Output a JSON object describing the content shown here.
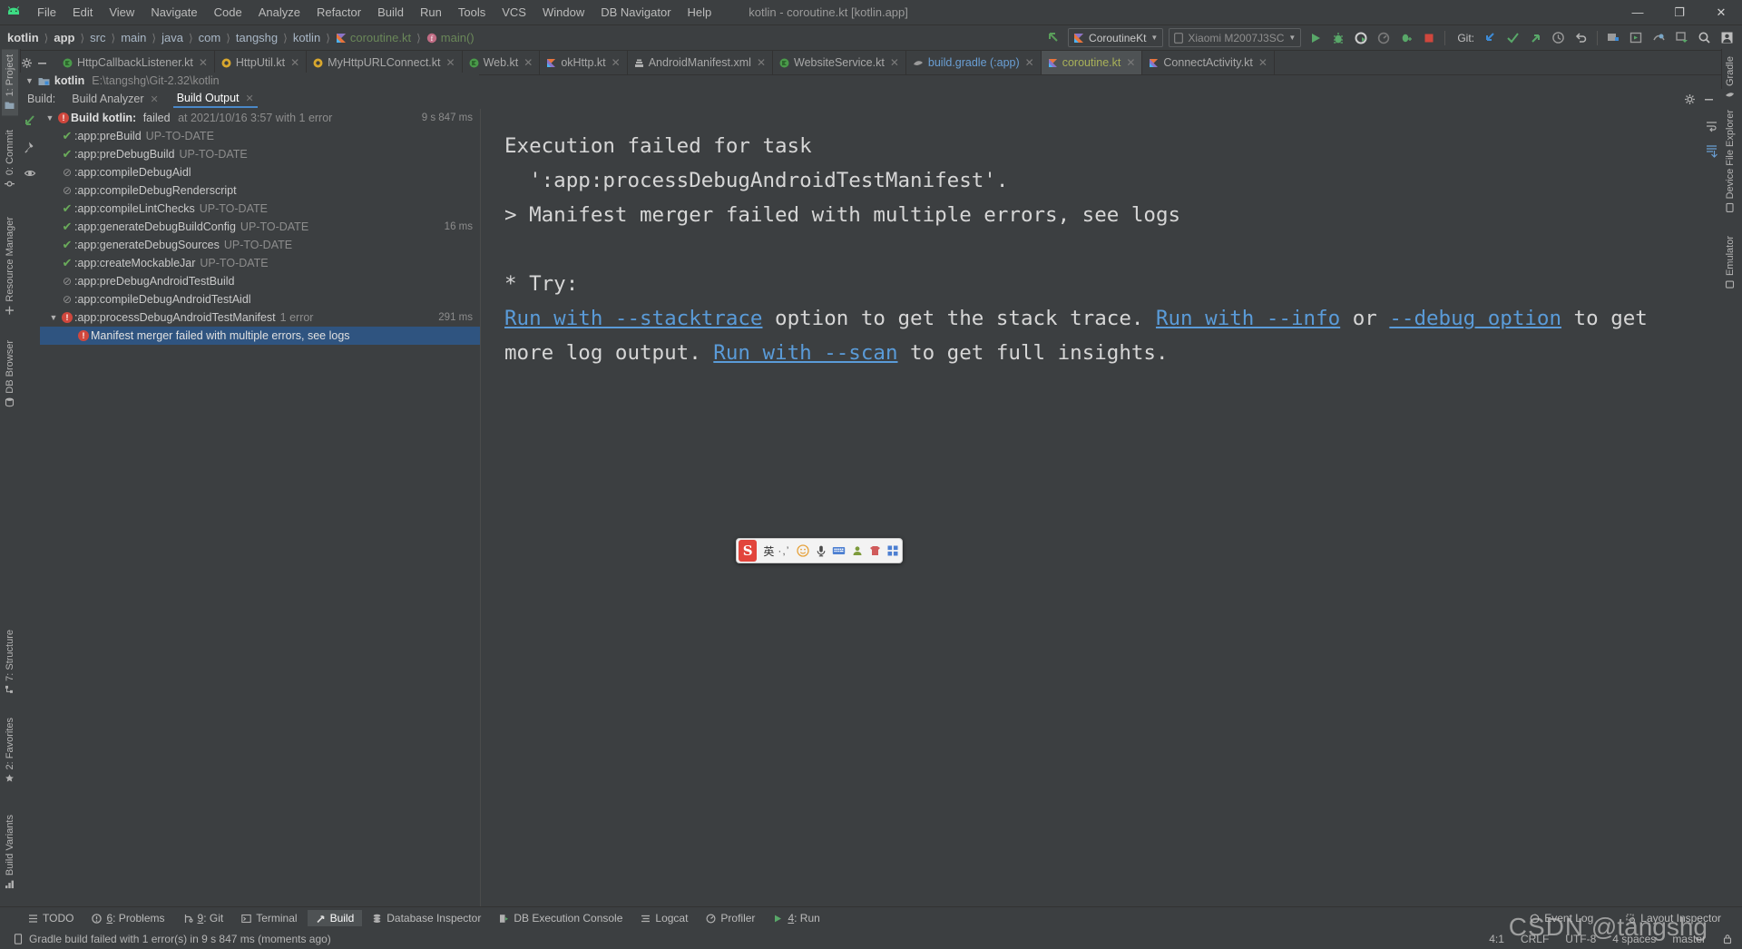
{
  "window": {
    "title": "kotlin - coroutine.kt [kotlin.app]",
    "minimize": "—",
    "maximize": "❐",
    "close": "✕"
  },
  "menu": {
    "items": [
      "File",
      "Edit",
      "View",
      "Navigate",
      "Code",
      "Analyze",
      "Refactor",
      "Build",
      "Run",
      "Tools",
      "VCS",
      "Window",
      "DB Navigator",
      "Help"
    ]
  },
  "breadcrumb": {
    "items": [
      {
        "label": "kotlin",
        "style": "bold"
      },
      {
        "label": "app",
        "style": "bold"
      },
      {
        "label": "src",
        "style": "normal"
      },
      {
        "label": "main",
        "style": "normal"
      },
      {
        "label": "java",
        "style": "normal"
      },
      {
        "label": "com",
        "style": "normal"
      },
      {
        "label": "tangshg",
        "style": "normal"
      },
      {
        "label": "kotlin",
        "style": "normal"
      },
      {
        "label": "coroutine.kt",
        "style": "file"
      },
      {
        "label": "main()",
        "style": "func"
      }
    ]
  },
  "toolbar": {
    "run_config": "CoroutineKt",
    "device": "Xiaomi M2007J3SC",
    "git_label": "Git:",
    "buttons": [
      "run-button",
      "debug-button",
      "run-coverage-button",
      "profiler-button",
      "attach-debugger-button",
      "stop-button"
    ],
    "git_buttons": [
      "update-project-icon",
      "commit-icon",
      "push-icon",
      "history-icon",
      "rollback-icon"
    ],
    "right_buttons": [
      "avd-manager-icon",
      "sdk-manager-icon",
      "layout-inspector-icon",
      "device-explorer-icon",
      "search-icon",
      "profile-icon"
    ]
  },
  "editor_tabs": [
    {
      "label": "HttpCallbackListener.kt",
      "icon": "kotlin-class-icon",
      "active": false
    },
    {
      "label": "HttpUtil.kt",
      "icon": "kotlin-object-icon",
      "active": false
    },
    {
      "label": "MyHttpURLConnect.kt",
      "icon": "kotlin-object-icon",
      "active": false
    },
    {
      "label": "Web.kt",
      "icon": "kotlin-class-icon",
      "active": false
    },
    {
      "label": "okHttp.kt",
      "icon": "kotlin-file-icon",
      "active": false
    },
    {
      "label": "AndroidManifest.xml",
      "icon": "manifest-icon",
      "active": false
    },
    {
      "label": "WebsiteService.kt",
      "icon": "kotlin-class-icon",
      "active": false
    },
    {
      "label": "build.gradle (:app)",
      "icon": "gradle-icon",
      "active": false
    },
    {
      "label": "coroutine.kt",
      "icon": "kotlin-file-icon",
      "active": true
    },
    {
      "label": "ConnectActivity.kt",
      "icon": "kotlin-file-icon",
      "active": false
    }
  ],
  "left_tool_tabs": [
    {
      "label": "1: Project",
      "icon": "project-icon",
      "selected": true
    },
    {
      "label": "0: Commit",
      "icon": "commit-icon",
      "selected": false
    },
    {
      "label": "Resource Manager",
      "icon": "resource-icon",
      "selected": false
    },
    {
      "label": "DB Browser",
      "icon": "db-icon",
      "selected": false
    },
    {
      "label": "7: Structure",
      "icon": "structure-icon",
      "selected": false
    },
    {
      "label": "2: Favorites",
      "icon": "star-icon",
      "selected": false
    },
    {
      "label": "Build Variants",
      "icon": "variants-icon",
      "selected": false
    }
  ],
  "right_tool_tabs": [
    {
      "label": "Gradle",
      "icon": "gradle-icon"
    },
    {
      "label": "Device File Explorer",
      "icon": "device-file-icon"
    },
    {
      "label": "Emulator",
      "icon": "emulator-icon"
    }
  ],
  "project_header": {
    "name": "kotlin",
    "path": "E:\\tangshg\\Git-2.32\\kotlin"
  },
  "build_window": {
    "label": "Build:",
    "tabs": [
      {
        "label": "Build Analyzer",
        "selected": false,
        "closable": true
      },
      {
        "label": "Build Output",
        "selected": true,
        "closable": true
      }
    ],
    "tree": [
      {
        "indent": 0,
        "twist": "⌄",
        "status": "error",
        "title": "Build kotlin:",
        "state": "failed",
        "detail": "at 2021/10/16 3:57 with 1 error",
        "time": "9 s 847 ms",
        "selected": false
      },
      {
        "indent": 1,
        "twist": "",
        "status": "ok",
        "title": ":app:preBuild",
        "state": "",
        "detail": "UP-TO-DATE",
        "time": "",
        "selected": false
      },
      {
        "indent": 1,
        "twist": "",
        "status": "ok",
        "title": ":app:preDebugBuild",
        "state": "",
        "detail": "UP-TO-DATE",
        "time": "",
        "selected": false
      },
      {
        "indent": 1,
        "twist": "",
        "status": "skip",
        "title": ":app:compileDebugAidl",
        "state": "",
        "detail": "",
        "time": "",
        "selected": false
      },
      {
        "indent": 1,
        "twist": "",
        "status": "skip",
        "title": ":app:compileDebugRenderscript",
        "state": "",
        "detail": "",
        "time": "",
        "selected": false
      },
      {
        "indent": 1,
        "twist": "",
        "status": "ok",
        "title": ":app:compileLintChecks",
        "state": "",
        "detail": "UP-TO-DATE",
        "time": "",
        "selected": false
      },
      {
        "indent": 1,
        "twist": "",
        "status": "ok",
        "title": ":app:generateDebugBuildConfig",
        "state": "",
        "detail": "UP-TO-DATE",
        "time": "16 ms",
        "selected": false
      },
      {
        "indent": 1,
        "twist": "",
        "status": "ok",
        "title": ":app:generateDebugSources",
        "state": "",
        "detail": "UP-TO-DATE",
        "time": "",
        "selected": false
      },
      {
        "indent": 1,
        "twist": "",
        "status": "ok",
        "title": ":app:createMockableJar",
        "state": "",
        "detail": "UP-TO-DATE",
        "time": "",
        "selected": false
      },
      {
        "indent": 1,
        "twist": "",
        "status": "skip",
        "title": ":app:preDebugAndroidTestBuild",
        "state": "",
        "detail": "",
        "time": "",
        "selected": false
      },
      {
        "indent": 1,
        "twist": "",
        "status": "skip",
        "title": ":app:compileDebugAndroidTestAidl",
        "state": "",
        "detail": "",
        "time": "",
        "selected": false
      },
      {
        "indent": 0,
        "twist": "⌄",
        "status": "error",
        "title": ":app:processDebugAndroidTestManifest",
        "state": "",
        "detail": "1 error",
        "time": "291 ms",
        "selected": false
      },
      {
        "indent": 2,
        "twist": "",
        "status": "error",
        "title": "Manifest merger failed with multiple errors, see logs",
        "state": "",
        "detail": "",
        "time": "",
        "selected": true
      }
    ],
    "console": {
      "segments": [
        {
          "text": "Execution failed for task\n  ':app:processDebugAndroidTestManifest'.\n> Manifest merger failed with multiple errors, see logs\n\n* Try:\n",
          "type": "plain"
        },
        {
          "text": "Run with --stacktrace",
          "type": "link"
        },
        {
          "text": " option to get the stack trace. ",
          "type": "plain"
        },
        {
          "text": "Run with --info",
          "type": "link"
        },
        {
          "text": " or ",
          "type": "plain"
        },
        {
          "text": "--debug option",
          "type": "link"
        },
        {
          "text": " to get more log output. ",
          "type": "plain"
        },
        {
          "text": "Run with --scan",
          "type": "link"
        },
        {
          "text": " to get full insights.",
          "type": "plain"
        }
      ]
    }
  },
  "ime": {
    "logo": "S",
    "mode": "英",
    "dots": "·,’",
    "icons": [
      "emoji-icon",
      "voice-icon",
      "keyboard-icon",
      "user-icon",
      "skin-icon",
      "apps-icon"
    ]
  },
  "bottom_tabs": [
    {
      "label": "TODO",
      "mnemonic": "",
      "icon": "todo-icon",
      "selected": false
    },
    {
      "label": ": Problems",
      "mnemonic": "6",
      "icon": "problems-icon",
      "selected": false
    },
    {
      "label": ": Git",
      "mnemonic": "9",
      "icon": "git-icon",
      "selected": false
    },
    {
      "label": "Terminal",
      "mnemonic": "",
      "icon": "terminal-icon",
      "selected": false
    },
    {
      "label": "Build",
      "mnemonic": "",
      "icon": "build-icon",
      "selected": true
    },
    {
      "label": "Database Inspector",
      "mnemonic": "",
      "icon": "database-icon",
      "selected": false
    },
    {
      "label": "DB Execution Console",
      "mnemonic": "",
      "icon": "db-console-icon",
      "selected": false
    },
    {
      "label": "Logcat",
      "mnemonic": "",
      "icon": "logcat-icon",
      "selected": false
    },
    {
      "label": "Profiler",
      "mnemonic": "",
      "icon": "profiler-icon",
      "selected": false
    },
    {
      "label": ": Run",
      "mnemonic": "4",
      "icon": "run-icon",
      "selected": false
    }
  ],
  "bottom_right_tabs": [
    {
      "label": "Event Log",
      "icon": "event-log-icon"
    },
    {
      "label": "Layout Inspector",
      "icon": "layout-inspector-icon"
    }
  ],
  "status": {
    "message": "Gradle build failed with 1 error(s) in 9 s 847 ms (moments ago)",
    "caret": "4:1",
    "line_sep": "CRLF",
    "encoding": "UTF-8",
    "indent": "4 spaces",
    "branch": "master"
  },
  "watermark": {
    "brand": "CSDN",
    "user": "@tangshg"
  },
  "colors": {
    "bg": "#3c3f41",
    "panel": "#2b2b2b",
    "selection": "#2f5480",
    "link": "#5a9bd8",
    "accent": "#4a88c7",
    "success": "#6aab5a",
    "error": "#d0473d",
    "text": "#bbbbbb"
  }
}
